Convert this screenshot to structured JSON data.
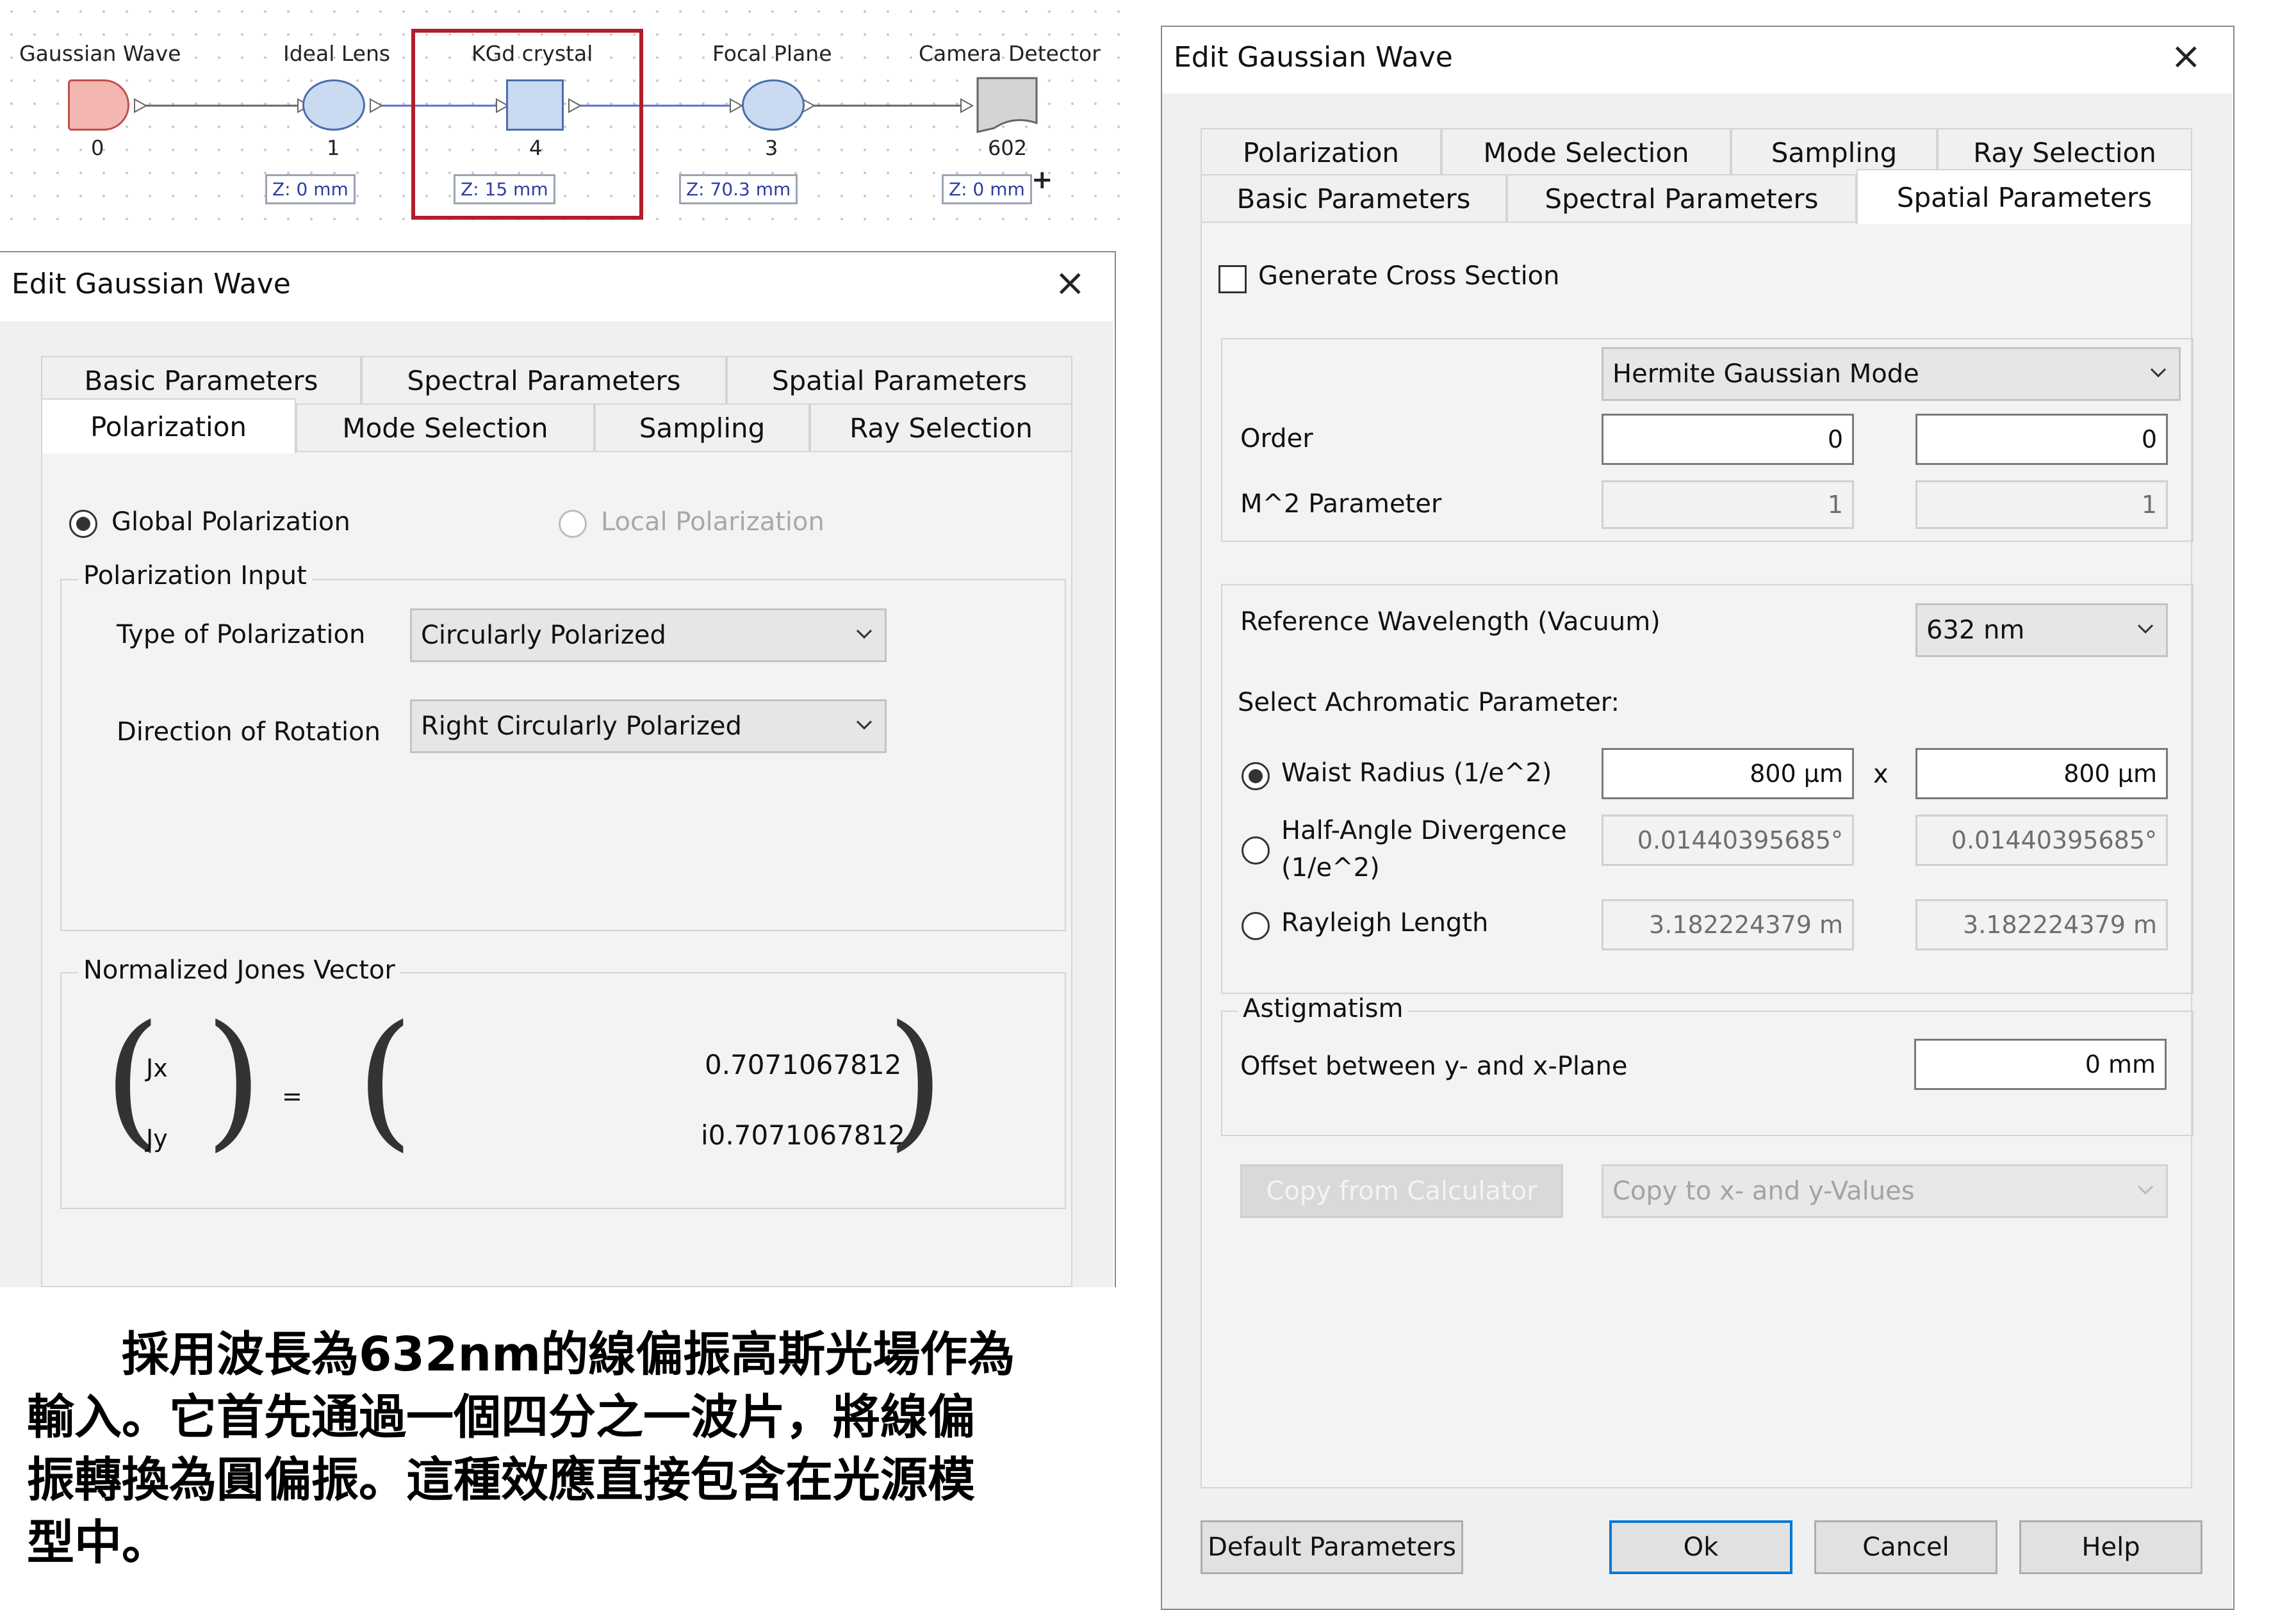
{
  "diagram": {
    "nodes": [
      {
        "label": "Gaussian Wave",
        "index": "0",
        "z": ""
      },
      {
        "label": "Ideal Lens",
        "index": "1",
        "z": "Z: 0 mm"
      },
      {
        "label": "KGd crystal",
        "index": "4",
        "z": "Z: 15 mm"
      },
      {
        "label": "Focal Plane",
        "index": "3",
        "z": "Z: 70.3 mm"
      },
      {
        "label": "Camera Detector",
        "index": "602",
        "z": "Z: 0 mm"
      }
    ],
    "add_symbol": "+",
    "colors": {
      "source": "#f4b6b0",
      "lens": "#c9daf1",
      "highlight": "#b01e2a",
      "link_blue": "#5a6bd6"
    }
  },
  "left_dialog": {
    "title": "Edit Gaussian Wave",
    "tabs_row1": [
      "Basic Parameters",
      "Spectral Parameters",
      "Spatial Parameters"
    ],
    "tabs_row2": [
      "Polarization",
      "Mode Selection",
      "Sampling",
      "Ray Selection"
    ],
    "active_tab": "Polarization",
    "radio_global": "Global Polarization",
    "radio_local": "Local Polarization",
    "group_input": "Polarization Input",
    "type_label": "Type of Polarization",
    "type_value": "Circularly Polarized",
    "direction_label": "Direction of Rotation",
    "direction_value": "Right Circularly Polarized",
    "group_jones": "Normalized Jones Vector",
    "jx": "Jx",
    "jy": "Jy",
    "equals": "=",
    "jx_value": "0.7071067812",
    "jy_value": "i0.7071067812"
  },
  "caption": {
    "line1": "　　採用波長為632nm的線偏振高斯光場作為",
    "line2": "輸入。它首先通過一個四分之一波片，將線偏",
    "line3": "振轉換為圓偏振。這種效應直接包含在光源模",
    "line4": "型中。"
  },
  "right_dialog": {
    "title": "Edit Gaussian Wave",
    "tabs_row1": [
      "Polarization",
      "Mode Selection",
      "Sampling",
      "Ray Selection"
    ],
    "tabs_row2": [
      "Basic Parameters",
      "Spectral Parameters",
      "Spatial Parameters"
    ],
    "active_tab": "Spatial Parameters",
    "generate_cross_section": "Generate Cross Section",
    "mode_value": "Hermite Gaussian Mode",
    "order_label": "Order",
    "order_x": "0",
    "order_y": "0",
    "m2_label": "M^2 Parameter",
    "m2_x": "1",
    "m2_y": "1",
    "ref_wavelength_label": "Reference Wavelength (Vacuum)",
    "ref_wavelength_value": "632 nm",
    "achromatic_label": "Select Achromatic Parameter:",
    "waist_label": "Waist Radius (1/e^2)",
    "waist_x": "800 µm",
    "times": "x",
    "waist_y": "800 µm",
    "divergence_label_1": "Half-Angle Divergence",
    "divergence_label_2": "(1/e^2)",
    "divergence_x": "0.01440395685°",
    "divergence_y": "0.01440395685°",
    "rayleigh_label": "Rayleigh Length",
    "rayleigh_x": "3.182224379 m",
    "rayleigh_y": "3.182224379 m",
    "astigmatism_group": "Astigmatism",
    "offset_label": "Offset between y- and x-Plane",
    "offset_value": "0 mm",
    "copy_calc_button": "Copy from Calculator",
    "copy_values_combo": "Copy to x- and y-Values",
    "default_button": "Default Parameters",
    "ok_button": "Ok",
    "cancel_button": "Cancel",
    "help_button": "Help"
  }
}
